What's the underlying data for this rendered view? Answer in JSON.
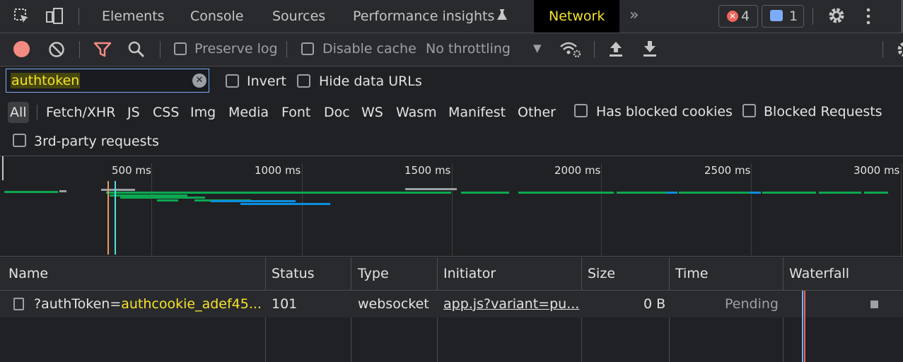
{
  "tabs": [
    {
      "label": "Elements"
    },
    {
      "label": "Console"
    },
    {
      "label": "Sources"
    },
    {
      "label": "Performance insights"
    },
    {
      "label": "Network"
    }
  ],
  "badges": {
    "errors": "4",
    "messages": "1"
  },
  "toolbar": {
    "preserve_log": "Preserve log",
    "disable_cache": "Disable cache",
    "throttling": "No throttling"
  },
  "filter": {
    "value": "authtoken",
    "invert": "Invert",
    "hide_data_urls": "Hide data URLs"
  },
  "types": [
    "All",
    "Fetch/XHR",
    "JS",
    "CSS",
    "Img",
    "Media",
    "Font",
    "Doc",
    "WS",
    "Wasm",
    "Manifest",
    "Other"
  ],
  "type_selected": "All",
  "extra_filters": {
    "has_blocked_cookies": "Has blocked cookies",
    "blocked_requests": "Blocked Requests",
    "third_party": "3rd-party requests"
  },
  "overview_ticks": [
    "500 ms",
    "1000 ms",
    "1500 ms",
    "2000 ms",
    "2500 ms",
    "3000 ms"
  ],
  "columns": [
    "Name",
    "Status",
    "Type",
    "Initiator",
    "Size",
    "Time",
    "Waterfall"
  ],
  "rows": [
    {
      "name_prefix": "?authToken=",
      "name_highlight": "authcookie_adef45...",
      "status": "101",
      "type": "websocket",
      "initiator": "app.js?variant=pu...",
      "size": "0 B",
      "time": "Pending"
    }
  ],
  "colors": {
    "accent_active_tab": "#f6e32a",
    "record": "#f28b82",
    "filter_funnel": "#f28b82",
    "error": "#ee675c",
    "message": "#7cacf8",
    "waterfall_green": "#0ca750",
    "waterfall_blue": "#0b8fe0"
  }
}
